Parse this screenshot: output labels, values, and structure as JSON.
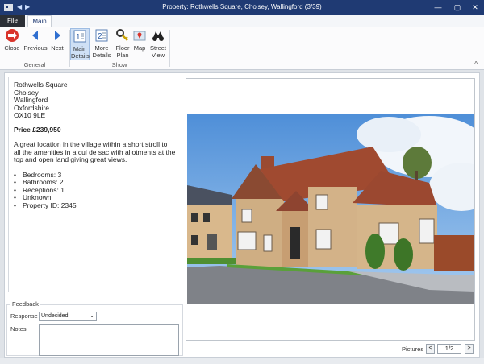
{
  "window": {
    "title": "Property: Rothwells Square, Cholsey, Wallingford (3/39)",
    "minimize": "—",
    "maximize": "▢",
    "close": "✕",
    "back_glyph": "◀",
    "forward_glyph": "▶"
  },
  "tabs": {
    "file": "File",
    "main": "Main"
  },
  "ribbon": {
    "close": "Close",
    "previous": "Previous",
    "next": "Next",
    "group_general": "General",
    "main_details_1": "Main",
    "main_details_2": "Details",
    "more_details_1": "More",
    "more_details_2": "Details",
    "floor_plan_1": "Floor",
    "floor_plan_2": "Plan",
    "map": "Map",
    "street_view_1": "Street",
    "street_view_2": "View",
    "group_show": "Show",
    "collapse_glyph": "^"
  },
  "property": {
    "address": [
      "Rothwells Square",
      "Cholsey",
      "Wallingford",
      "Oxfordshire",
      "OX10 9LE"
    ],
    "price": "Price £239,950",
    "description": "A great location in the village within a short stroll to all the amenities in a cul de sac with allotments at the top and open land giving great views.",
    "features": [
      "Bedrooms: 3",
      "Bathrooms: 2",
      "Receptions: 1",
      "Unknown",
      "Property ID: 2345"
    ]
  },
  "feedback": {
    "legend": "Feedback",
    "response_label": "Response",
    "response_value": "Undecided",
    "notes_label": "Notes"
  },
  "pictures": {
    "label": "Pictures",
    "prev": "<",
    "next": ">",
    "count": "1/2"
  },
  "colors": {
    "titlebar": "#1f3a73",
    "accent": "#cfe0f5",
    "close_red": "#d9342b"
  }
}
